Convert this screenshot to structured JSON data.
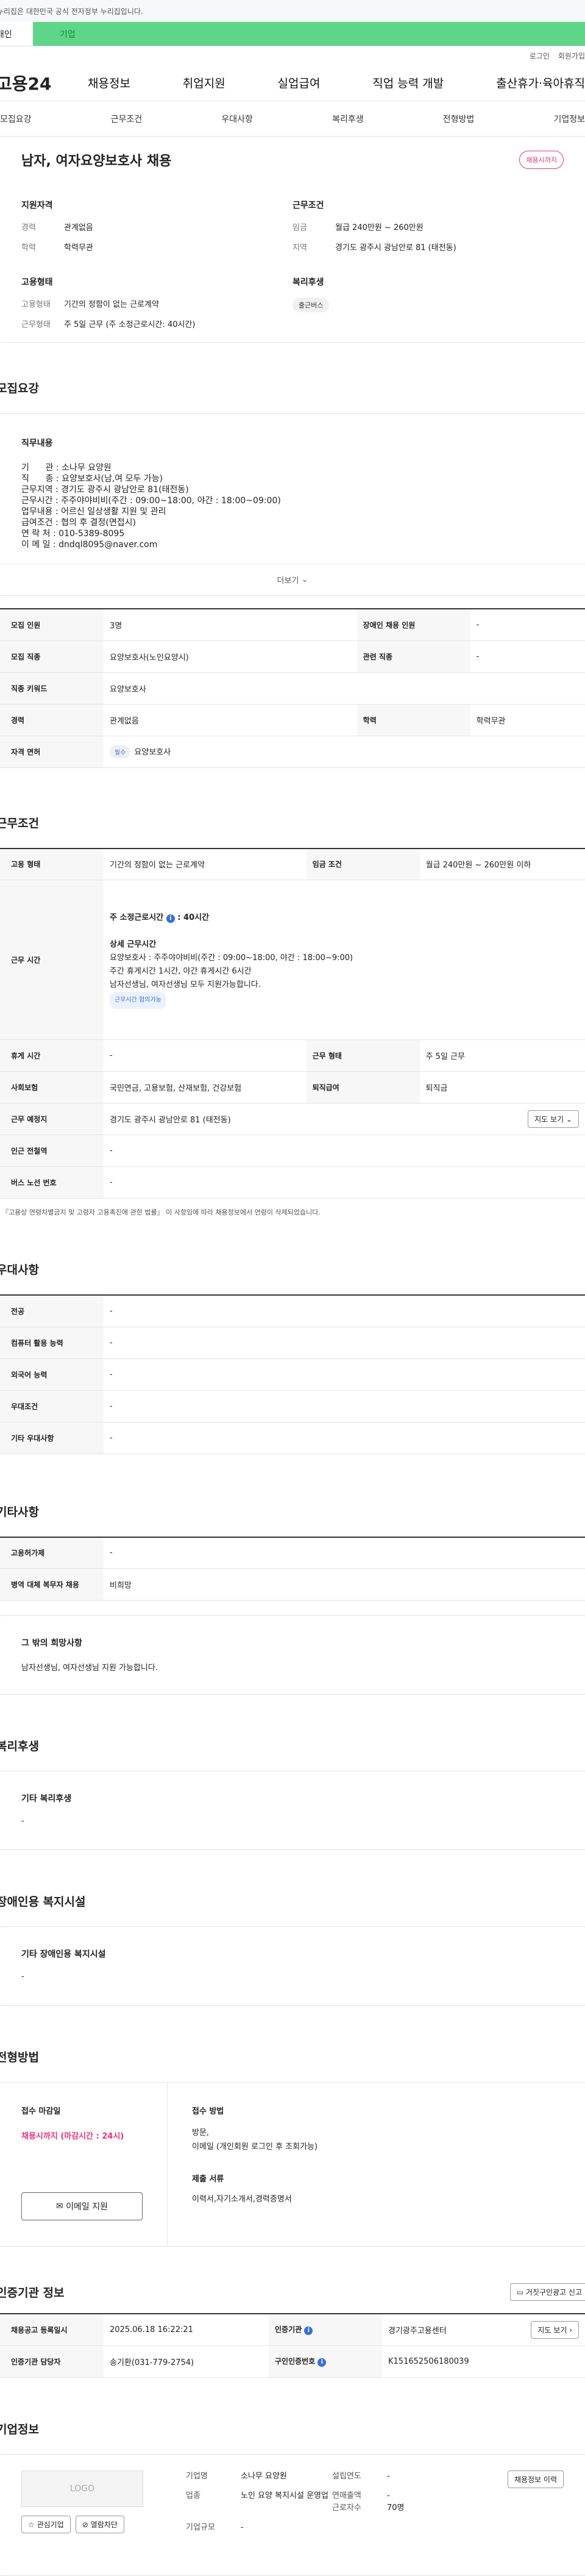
{
  "gov_banner": "이 누리집은 대한민국 공식 전자정부 누리집입니다.",
  "tabs": {
    "personal": "개인",
    "business": "기업"
  },
  "util": {
    "login": "로그인",
    "join": "회원가입"
  },
  "logo": "고용24",
  "gnb": [
    "채용정보",
    "취업지원",
    "실업급여",
    "직업 능력 개발",
    "출산휴가·육아휴직"
  ],
  "subnav": [
    "모집요강",
    "근무조건",
    "우대사항",
    "복리후생",
    "전형방법",
    "기업정보"
  ],
  "summary": {
    "title": "남자, 여자요양보호사 채용",
    "badge": "채용시까지",
    "qual_title": "지원자격",
    "qual": [
      {
        "k": "경력",
        "v": "관계없음"
      },
      {
        "k": "학력",
        "v": "학력무관"
      }
    ],
    "cond_title": "근무조건",
    "cond": [
      {
        "k": "임금",
        "v": "월급 240만원 ~ 260만원"
      },
      {
        "k": "지역",
        "v": "경기도 광주시 광남안로 81 (태전동)"
      }
    ],
    "emp_title": "고용형태",
    "emp": [
      {
        "k": "고용형태",
        "v": "기간의 정함이 없는 근로계약"
      },
      {
        "k": "근무형태",
        "v": "주 5일 근무 (주 소정근로시간: 40시간)"
      }
    ],
    "welfare_title": "복리후생",
    "welfare_chip": "출근버스"
  },
  "recruit": {
    "heading": "모집요강",
    "job_title": "직무내용",
    "job_text": "기      관 : 소나무 요양원\n직      종 : 요양보호사(남,여 모두 가능)\n근무지역 : 경기도 광주시 광남안로 81(태전동)\n근무시간 : 주주야야비비(주간 : 09:00~18:00, 야간 : 18:00~09:00)\n업무내용 : 어르신 일상생활 지원 및 관리\n급여조건 : 협의 후 결정(면접시)\n연 락 처 : 010-5389-8095\n이 메 일 : dndql8095@naver.com",
    "more": "더보기",
    "rows": [
      {
        "k": "모집 인원",
        "v": "3명",
        "k2": "장애인 채용 인원",
        "v2": "-"
      },
      {
        "k": "모집 직종",
        "v": "요양보호사(노인요양시)",
        "k2": "관련 직종",
        "v2": "-"
      },
      {
        "k": "직종 키워드",
        "v": "요양보호사"
      },
      {
        "k": "경력",
        "v": "관계없음",
        "k2": "학력",
        "v2": "학력무관"
      },
      {
        "k": "자격 면허",
        "chip": "필수",
        "v": "요양보호사"
      }
    ]
  },
  "conditions": {
    "heading": "근무조건",
    "emp_type_k": "고용 형태",
    "emp_type_v": "기간의 정함이 없는 근로계약",
    "wage_k": "임금 조건",
    "wage_v": "월급 240만원 ~ 260만원 이하",
    "hours_k": "근무 시간",
    "hours_main": "주 소정근로시간",
    "hours_val": "40시간",
    "hours_detail_t": "상세 근무시간",
    "hours_detail": [
      "요양보호사 : 주주야야비비(주간 : 09:00~18:00, 야간 : 18:00~9:00)",
      "주간 휴게시간 1시간, 야간 휴게시간 6시간",
      "남자선생님, 여자선생님 모두 지원가능합니다."
    ],
    "hours_chip": "근무시간 협의가능",
    "rows": [
      {
        "k": "휴게 시간",
        "v": "-",
        "k2": "근무 형태",
        "v2": "주 5일 근무"
      },
      {
        "k": "사회보험",
        "v": "국민연금, 고용보험, 산재보험, 건강보험",
        "k2": "퇴직급여",
        "v2": "퇴직금"
      }
    ],
    "place_k": "근무 예정지",
    "place_v": "경기도 광주시 광남안로 81 (태전동)",
    "map_btn": "지도 보기",
    "station_k": "인근 전철역",
    "station_v": "-",
    "bus_k": "버스 노선 번호",
    "bus_v": "-",
    "note": "* 『고용상 연령차별금지 및 고령자 고용촉진에 관한 법률』 이 사항임에 따라 채용정보에서 연령이 삭제되었습니다."
  },
  "preference": {
    "heading": "우대사항",
    "rows": [
      {
        "k": "전공",
        "v": "-"
      },
      {
        "k": "컴퓨터 활용 능력",
        "v": "-"
      },
      {
        "k": "외국어 능력",
        "v": "-"
      },
      {
        "k": "우대조건",
        "v": "-"
      },
      {
        "k": "기타 우대사항",
        "v": "-"
      }
    ]
  },
  "other": {
    "heading": "기타사항",
    "rows": [
      {
        "k": "고용허가제",
        "v": "-"
      },
      {
        "k": "병역 대체 복무자 채용",
        "v": "비희망"
      }
    ],
    "box_t": "그 밖의 희망사항",
    "box_v": "남자선생님, 여자선생님 지원 가능합니다."
  },
  "welfare": {
    "heading": "복리후생",
    "box_t": "기타 복리후생",
    "box_v": "-"
  },
  "disabled": {
    "heading": "장애인용 복지시설",
    "box_t": "기타 장애인용 복지시설",
    "box_v": "-"
  },
  "apply": {
    "heading": "전형방법",
    "deadline_t": "접수 마감일",
    "deadline_v": "채용시까지 (마감시간 : 24시)",
    "email_btn": "이메일 지원",
    "method_t": "접수 방법",
    "method_v1": "방문,",
    "method_v2": "이메일 (개인회원 로그인 후 조회가능)",
    "docs_t": "제출 서류",
    "docs_v": "이력서,자기소개서,경력증명서"
  },
  "cert": {
    "heading": "인증기관 정보",
    "report": "거짓구인광고 신고",
    "rows": [
      {
        "k": "채용공고 등록일시",
        "v": "2025.06.18 16:22:21",
        "k2": "인증기관",
        "v2": "경기광주고용센터",
        "btn": "지도 보기"
      },
      {
        "k": "인증기관 담당자",
        "v": "송기환(031-779-2754)",
        "k2": "구인인증번호",
        "v2": "K151652506180039"
      }
    ]
  },
  "company": {
    "heading": "기업정보",
    "logo": "LOGO",
    "fav": "관심기업",
    "block": "열람차단",
    "hist": "채용정보 이력",
    "info": [
      {
        "k": "기업명",
        "v": "소나무 요양원",
        "k2": "설립연도",
        "v2": "-"
      },
      {
        "k": "업종",
        "v": "노인 요양 복지시설 운영업",
        "k2": "연매출액",
        "v2": "-"
      },
      {
        "k": "",
        "v": "",
        "k2": "근로자수",
        "v2": "70명"
      },
      {
        "k": "기업규모",
        "v": "-"
      }
    ]
  }
}
